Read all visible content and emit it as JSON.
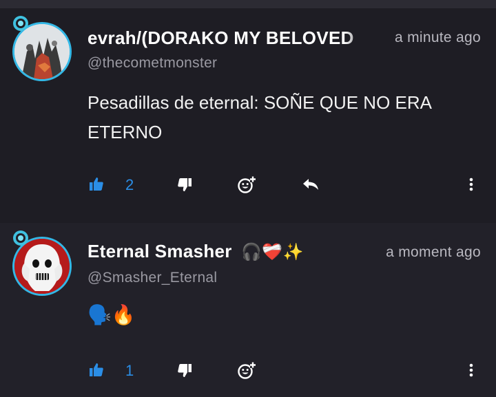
{
  "comments": [
    {
      "author": "evrah/(DORAKO MY BELOVED",
      "time": "a minute ago",
      "handle": "@thecometmonster",
      "text": "Pesadillas de eternal: SOÑE QUE NO ERA ETERNO",
      "likes": "2",
      "has_reply": true
    },
    {
      "author": "Eternal Smasher",
      "author_emojis": "🎧❤️‍🩹✨",
      "time": "a moment ago",
      "handle": "@Smasher_Eternal",
      "text": "🗣️🔥",
      "likes": "1",
      "has_reply": false
    }
  ],
  "colors": {
    "accent": "#2b8ee6",
    "avatar_ring": "#33b8e6",
    "background": "#1e1d24"
  },
  "icons": [
    "thumbs-up-icon",
    "thumbs-down-icon",
    "add-reaction-icon",
    "reply-icon",
    "more-vertical-icon"
  ]
}
